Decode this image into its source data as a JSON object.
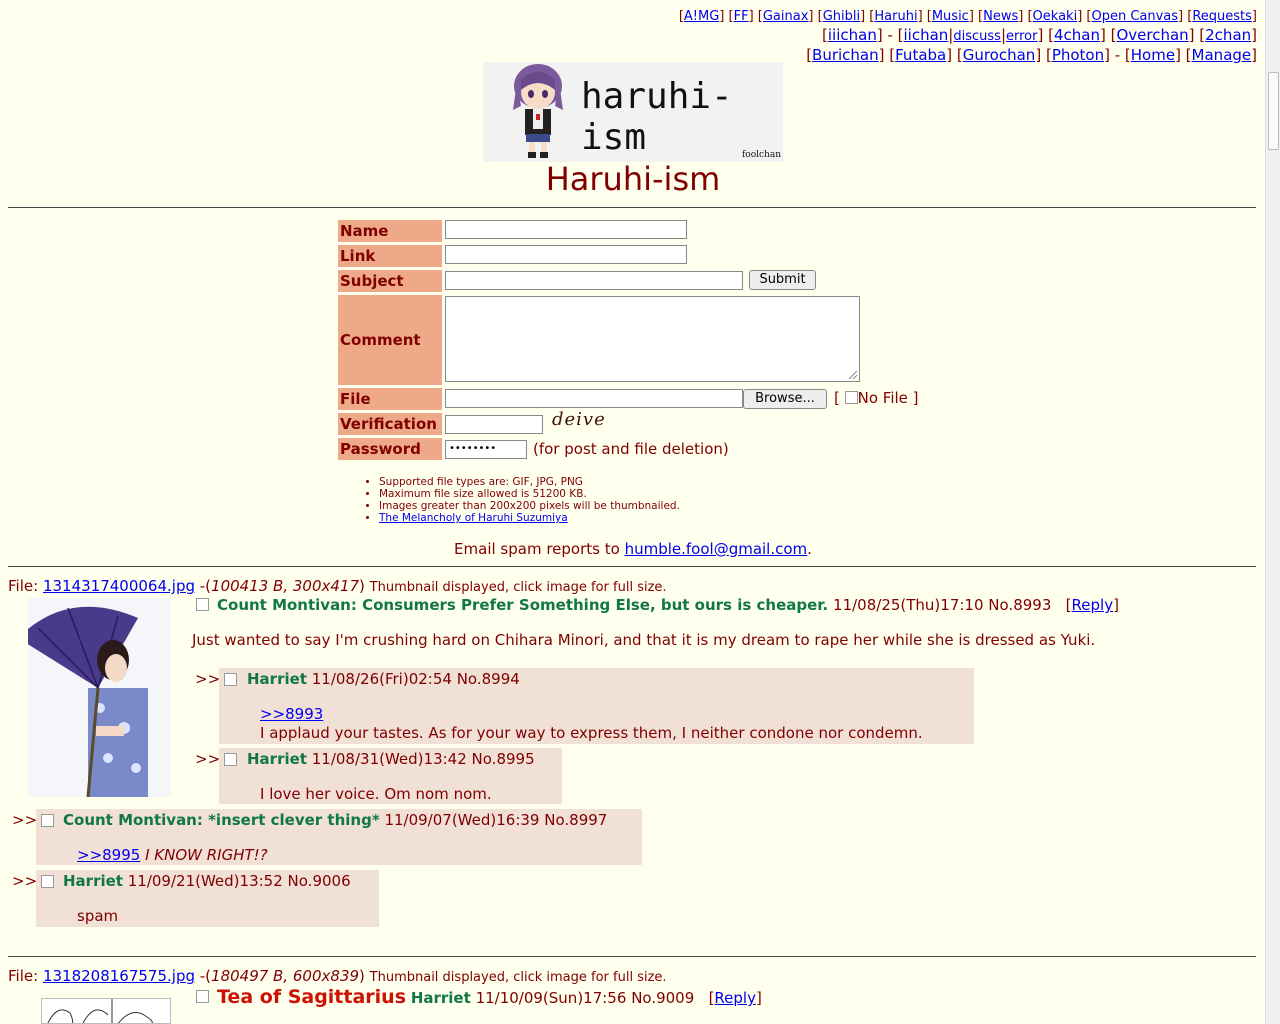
{
  "nav": {
    "row1": [
      "A!MG",
      "FF",
      "Gainax",
      "Ghibli",
      "Haruhi",
      "Music",
      "News",
      "Oekaki",
      "Open Canvas",
      "Requests"
    ],
    "row2a": "iiichan",
    "row2b": [
      "iichan",
      "discuss",
      "error"
    ],
    "row2c": [
      "4chan",
      "Overchan",
      "2chan"
    ],
    "row3a": [
      "Burichan",
      "Futaba",
      "Gurochan",
      "Photon"
    ],
    "row3b": [
      "Home",
      "Manage"
    ]
  },
  "logo": {
    "text": "haruhi-ism",
    "small": "foolchan"
  },
  "board_title": "Haruhi-ism",
  "form": {
    "name_label": "Name",
    "link_label": "Link",
    "subject_label": "Subject",
    "comment_label": "Comment",
    "file_label": "File",
    "verification_label": "Verification",
    "password_label": "Password",
    "submit": "Submit",
    "browse": "Browse...",
    "nofile": "No File",
    "captcha": "deive",
    "password_value": "••••••••",
    "password_note": "(for post and file deletion)"
  },
  "rules": [
    "Supported file types are: GIF, JPG, PNG",
    "Maximum file size allowed is 51200 KB.",
    "Images greater than 200x200 pixels will be thumbnailed.",
    "The Melancholy of Haruhi Suzumiya"
  ],
  "spam": {
    "prefix": "Email spam reports to",
    "email": "humble.fool@gmail.com"
  },
  "threads": [
    {
      "file_prefix": "File:",
      "filename": "1314317400064.jpg",
      "filemeta": "100413 B, 300x417",
      "note": "Thumbnail displayed, click image for full size.",
      "op": {
        "name": "Count Montivan: Consumers Prefer Something Else, but ours is cheaper.",
        "date": "11/08/25(Thu)17:10",
        "no": "No.8993",
        "reply_link": "Reply",
        "comment": "Just wanted to say I'm crushing hard on Chihara Minori, and that it is my dream to rape her while she is dressed as Yuki."
      },
      "replies": [
        {
          "name": "Harriet",
          "date": "11/08/26(Fri)02:54",
          "no": "No.8994",
          "quote": ">>8993",
          "text": "I applaud your tastes. As for your way to express them, I neither condone nor condemn."
        },
        {
          "name": "Harriet",
          "date": "11/08/31(Wed)13:42",
          "no": "No.8995",
          "text": "I love her voice. Om nom nom."
        },
        {
          "name": "Count Montivan: *insert clever thing*",
          "date": "11/09/07(Wed)16:39",
          "no": "No.8997",
          "quote": ">>8995",
          "text": "I KNOW RIGHT!?"
        },
        {
          "name": "Harriet",
          "date": "11/09/21(Wed)13:52",
          "no": "No.9006",
          "text": "spam"
        }
      ]
    },
    {
      "file_prefix": "File:",
      "filename": "1318208167575.jpg",
      "filemeta": "180497 B, 600x839",
      "note": "Thumbnail displayed, click image for full size.",
      "op": {
        "subject": "Tea of Sagittarius",
        "name": "Harriet",
        "date": "11/10/09(Sun)17:56",
        "no": "No.9009",
        "reply_link": "Reply"
      }
    }
  ],
  "reply_arrow": ">>"
}
